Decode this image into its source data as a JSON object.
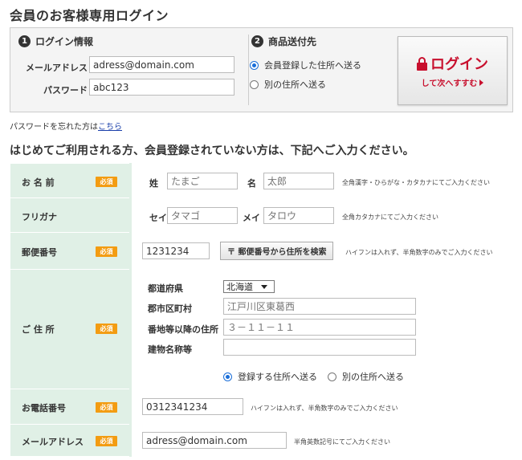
{
  "page": {
    "title": "会員のお客様専用ログイン"
  },
  "login": {
    "section1": {
      "number": "1",
      "title": "ログイン情報"
    },
    "email_label": "メールアドレス",
    "email_value": "adress@domain.com",
    "password_label": "パスワード",
    "password_value": "abc123",
    "section2": {
      "number": "2",
      "title": "商品送付先"
    },
    "radio_registered": "会員登録した住所へ送る",
    "radio_other": "別の住所へ送る",
    "button_main": "ログイン",
    "button_sub": "して次へすすむ",
    "forgot_text": "パスワードを忘れた方は",
    "forgot_link": "こちら"
  },
  "register": {
    "heading": "はじめてご利用される方、会員登録されていない方は、下記へご入力ください。",
    "required_badge": "必須",
    "name": {
      "label": "お 名 前",
      "sei_label": "姓",
      "sei_placeholder": "たまご",
      "mei_label": "名",
      "mei_placeholder": "太郎",
      "hint": "全角漢字・ひらがな・カタカナにてご入力ください"
    },
    "furigana": {
      "label": "フリガナ",
      "sei_label": "セイ",
      "sei_placeholder": "タマゴ",
      "mei_label": "メイ",
      "mei_placeholder": "タロウ",
      "hint": "全角カタカナにてご入力ください"
    },
    "zip": {
      "label": "郵便番号",
      "value": "1231234",
      "button": "〒 郵便番号から住所を検索",
      "hint": "ハイフンは入れず、半角数字のみでご入力ください"
    },
    "address": {
      "label": "ご 住 所",
      "pref_label": "都道府県",
      "pref_value": "北海道",
      "city_label": "郡市区町村",
      "city_placeholder": "江戸川区東葛西",
      "street_label": "番地等以降の住所",
      "street_placeholder": "３－１１－１１",
      "building_label": "建物名称等",
      "building_placeholder": "",
      "radio_registered": "登録する住所へ送る",
      "radio_other": "別の住所へ送る"
    },
    "phone": {
      "label": "お電話番号",
      "value": "0312341234",
      "hint": "ハイフンは入れず、半角数字のみでご入力ください"
    },
    "email": {
      "label": "メールアドレス",
      "value": "adress@domain.com",
      "hint": "半角英数記号にてご入力ください"
    }
  },
  "colors": {
    "accent_red": "#c8102e",
    "header_cell": "#e0f0e6",
    "required_badge": "#f39c12",
    "link_blue": "#1a3faa"
  }
}
